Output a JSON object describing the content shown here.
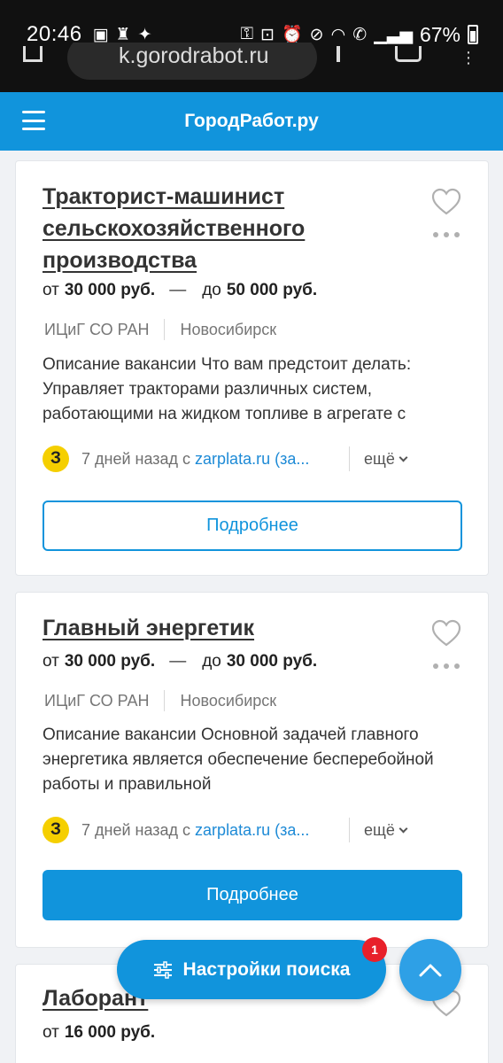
{
  "status_bar": {
    "time": "20:46",
    "battery": "67%"
  },
  "browser": {
    "url": "k.gorodrabot.ru"
  },
  "header": {
    "brand": "ГородРабот.ру"
  },
  "cards": [
    {
      "title": "Тракторист-машинист сельскохозяйственного производства",
      "salary_from_prefix": "от",
      "salary_from": "30 000 руб.",
      "salary_dash": "—",
      "salary_to_prefix": "до",
      "salary_to": "50 000 руб.",
      "company": "ИЦиГ СО РАН",
      "city": "Новосибирск",
      "description": "Описание вакансии Что вам предстоит делать: Управляет тракторами различных систем, работающими на жидком топливе в агрегате с",
      "source_badge": "З",
      "source_prefix": "7 дней назад с ",
      "source_link": "zarplata.ru (за...",
      "more": "ещё",
      "button": "Подробнее"
    },
    {
      "title": "Главный энергетик",
      "salary_from_prefix": "от",
      "salary_from": "30 000 руб.",
      "salary_dash": "—",
      "salary_to_prefix": "до",
      "salary_to": "30 000 руб.",
      "company": "ИЦиГ СО РАН",
      "city": "Новосибирск",
      "description": "Описание вакансии Основной задачей главного энергетика является обеспечение бесперебойной работы и правильной",
      "source_badge": "З",
      "source_prefix": "7 дней назад с ",
      "source_link": "zarplata.ru (за...",
      "more": "ещё",
      "button": "Подробнее"
    },
    {
      "title": "Лаборант",
      "salary_from_prefix": "от",
      "salary_from": "16 000 руб."
    }
  ],
  "floating": {
    "search_settings": "Настройки поиска",
    "badge_count": "1"
  },
  "colors": {
    "brand_blue": "#1194dc",
    "badge_red": "#e8202a",
    "zarplata_yellow": "#f5cf00"
  }
}
